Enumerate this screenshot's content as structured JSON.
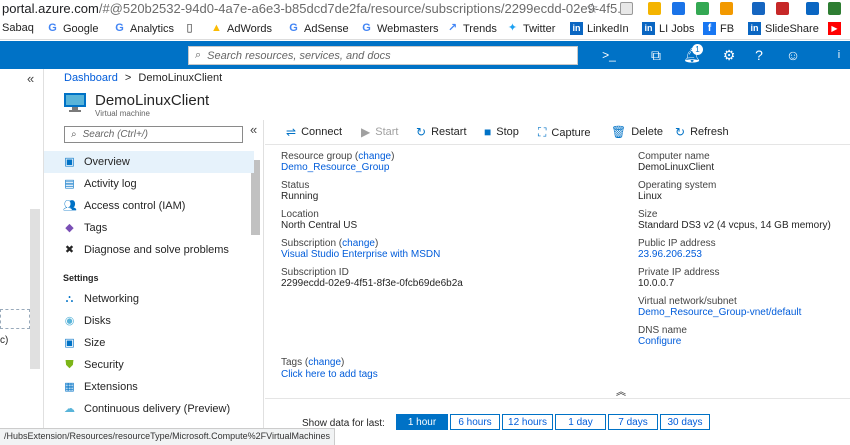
{
  "browser": {
    "url_main": "portal.azure.com",
    "url_rest": "/#@520b2532-94d0-4a7e-a6e3-b85dcd7de2fa/resource/subscriptions/2299ecdd-02e9-4f5..."
  },
  "bookmarks": [
    {
      "label": "Sabaq",
      "icon": "sabaq-icon"
    },
    {
      "label": "Google",
      "icon": "google-icon"
    },
    {
      "label": "Analytics",
      "icon": "google-icon"
    },
    {
      "label": "",
      "icon": "page-icon"
    },
    {
      "label": "AdWords",
      "icon": "google-icon"
    },
    {
      "label": "AdSense",
      "icon": "google-icon"
    },
    {
      "label": "Webmasters",
      "icon": "google-icon"
    },
    {
      "label": "Trends",
      "icon": "trends-icon"
    },
    {
      "label": "Twitter",
      "icon": "twitter-icon"
    },
    {
      "label": "LinkedIn",
      "icon": "linkedin-icon"
    },
    {
      "label": "LI Jobs",
      "icon": "linkedin-icon"
    },
    {
      "label": "FB",
      "icon": "facebook-icon"
    },
    {
      "label": "SlideShare",
      "icon": "linkedin-icon"
    }
  ],
  "topbar": {
    "search_placeholder": "Search resources, services, and docs",
    "notification_count": "1",
    "colors": {
      "bar": "#0072c6"
    }
  },
  "left_strip": {
    "collapse": "«",
    "partial_text": "c)"
  },
  "breadcrumb": {
    "root": "Dashboard",
    "sep": ">",
    "current": "DemoLinuxClient"
  },
  "resource": {
    "name": "DemoLinuxClient",
    "type": "Virtual machine"
  },
  "menu": {
    "collapse": "«",
    "search_placeholder": "Search (Ctrl+/)",
    "items": [
      {
        "label": "Overview",
        "icon": "monitor-icon",
        "selected": true
      },
      {
        "label": "Activity log",
        "icon": "activity-log-icon"
      },
      {
        "label": "Access control (IAM)",
        "icon": "people-icon"
      },
      {
        "label": "Tags",
        "icon": "tag-icon"
      },
      {
        "label": "Diagnose and solve problems",
        "icon": "wrench-icon"
      }
    ],
    "settings_header": "Settings",
    "settings_items": [
      {
        "label": "Networking",
        "icon": "network-icon"
      },
      {
        "label": "Disks",
        "icon": "disk-icon"
      },
      {
        "label": "Size",
        "icon": "size-icon"
      },
      {
        "label": "Security",
        "icon": "shield-icon"
      },
      {
        "label": "Extensions",
        "icon": "extensions-icon"
      },
      {
        "label": "Continuous delivery (Preview)",
        "icon": "delivery-icon"
      }
    ]
  },
  "toolbar": {
    "connect": "Connect",
    "start": "Start",
    "restart": "Restart",
    "stop": "Stop",
    "capture": "Capture",
    "delete": "Delete",
    "refresh": "Refresh"
  },
  "essentials": {
    "change": "change",
    "resource_group_label": "Resource group",
    "resource_group": "Demo_Resource_Group",
    "status_label": "Status",
    "status": "Running",
    "location_label": "Location",
    "location": "North Central US",
    "subscription_label": "Subscription",
    "subscription": "Visual Studio Enterprise with MSDN",
    "subscription_id_label": "Subscription ID",
    "subscription_id": "2299ecdd-02e9-4f51-8f3e-0fcb69de6b2a",
    "computer_name_label": "Computer name",
    "computer_name": "DemoLinuxClient",
    "os_label": "Operating system",
    "os": "Linux",
    "size_label": "Size",
    "size": "Standard DS3 v2 (4 vcpus, 14 GB memory)",
    "public_ip_label": "Public IP address",
    "public_ip": "23.96.206.253",
    "private_ip_label": "Private IP address",
    "private_ip": "10.0.0.7",
    "vnet_label": "Virtual network/subnet",
    "vnet": "Demo_Resource_Group-vnet/default",
    "dns_label": "DNS name",
    "dns": "Configure",
    "tags_label": "Tags",
    "tags_link": "Click here to add tags"
  },
  "timerange": {
    "label": "Show data for last:",
    "options": [
      "1 hour",
      "6 hours",
      "12 hours",
      "1 day",
      "7 days",
      "30 days"
    ],
    "selected": "1 hour"
  },
  "statusbar": {
    "text": "/HubsExtension/Resources/resourceType/Microsoft.Compute%2FVirtualMachines"
  }
}
